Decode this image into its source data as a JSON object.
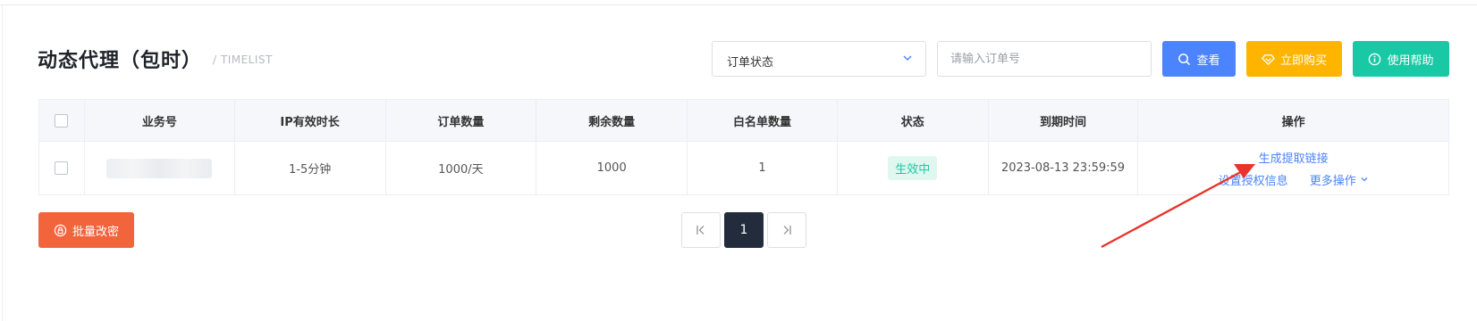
{
  "page": {
    "title": "动态代理（包时）",
    "subtitle": "/ TIMELIST"
  },
  "filters": {
    "status_select": {
      "value": "订单状态"
    },
    "order_input": {
      "placeholder": "请输入订单号"
    }
  },
  "buttons": {
    "search": "查看",
    "buy": "立即购买",
    "help": "使用帮助",
    "batch": "批量改密"
  },
  "colors": {
    "primary": "#4c84ff",
    "warning": "#ffb400",
    "success": "#19c9a5",
    "danger": "#f2643c",
    "pager_active": "#222c3c",
    "arrow": "#e8342c"
  },
  "table": {
    "headers": [
      "业务号",
      "IP有效时长",
      "订单数量",
      "剩余数量",
      "白名单数量",
      "状态",
      "到期时间",
      "操作"
    ],
    "rows": [
      {
        "biz_no": "",
        "ip_duration": "1-5分钟",
        "order_qty": "1000/天",
        "remaining": "1000",
        "whitelist": "1",
        "status": "生效中",
        "expire": "2023-08-13 23:59:59",
        "actions": {
          "gen_link": "生成提取链接",
          "set_auth": "设置授权信息",
          "more": "更多操作"
        }
      }
    ]
  },
  "pagination": {
    "current": "1"
  }
}
